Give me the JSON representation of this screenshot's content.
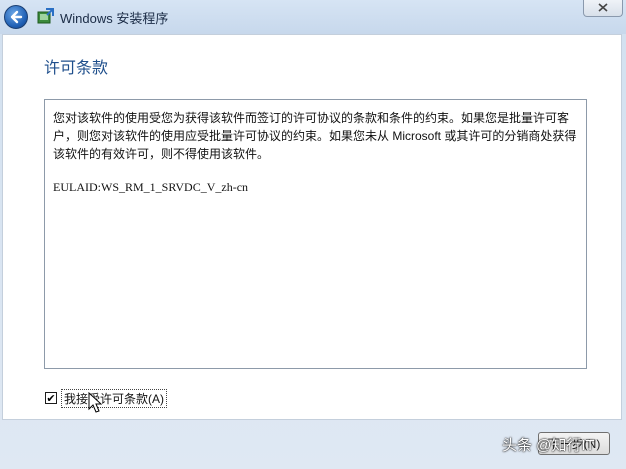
{
  "window": {
    "title": "Windows 安装程序",
    "back_icon": "back-arrow-icon",
    "app_icon": "setup-icon",
    "close_icon": "close-icon"
  },
  "page": {
    "heading": "许可条款",
    "license_paragraph": "您对该软件的使用受您为获得该软件而签订的许可协议的条款和条件的约束。如果您是批量许可客户，则您对该软件的使用应受批量许可协议的约束。如果您未从 Microsoft 或其许可的分销商处获得该软件的有效许可，则不得使用该软件。",
    "eula_id": "EULAID:WS_RM_1_SRVDC_V_zh-cn"
  },
  "accept": {
    "checked": true,
    "check_mark": "✔",
    "label": "我接受许可条款(A)"
  },
  "footer": {
    "next_label": "下一步(N)",
    "watermark": "头条 @知行IT"
  },
  "colors": {
    "accent": "#1f4f8c",
    "title_bar": "#d6e4f4",
    "content_bg": "#ffffff"
  }
}
